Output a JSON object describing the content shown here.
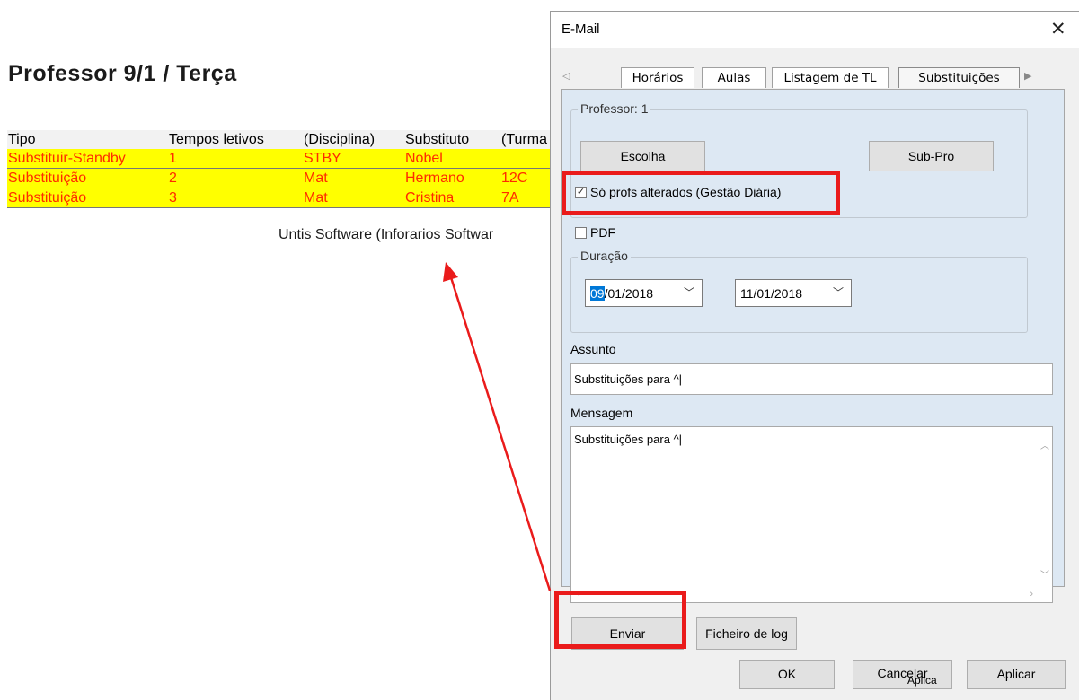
{
  "report": {
    "title": "Professor  9/1 / Terça",
    "headers": [
      "Tipo",
      "Tempos letivos",
      "(Disciplina)",
      "Substituto",
      "(Turma"
    ],
    "rows": [
      [
        "Substituir-Standby",
        "1",
        "STBY",
        "Nobel",
        ""
      ],
      [
        "Substituição",
        "2",
        "Mat",
        "Hermano",
        "12C"
      ],
      [
        "Substituição",
        "3",
        "Mat",
        "Cristina",
        "7A"
      ]
    ],
    "footer": "Untis Software (Inforarios Softwar",
    "row_bg_color": "#ffff00",
    "row_text_color": "#ff2a00"
  },
  "dialog": {
    "title": "E-Mail",
    "close_icon": "close-icon",
    "tabs": [
      "Horários",
      "Aulas",
      "Listagem de TL",
      "Substituições"
    ],
    "active_tab": "Substituições",
    "professor_group": "Professor: 1",
    "escolha_button": "Escolha",
    "subpro_button": "Sub-Pro",
    "checkbox_changed_label": "Só profs alterados (Gestão Diária)",
    "checkbox_changed_checked": true,
    "checkbox_pdf_label": "PDF",
    "checkbox_pdf_checked": false,
    "duracao_group": "Duração",
    "date_from_prefix": "09",
    "date_from_rest": "/01/2018",
    "date_to": "11/01/2018",
    "assunto_label": "Assunto",
    "assunto_value": "Substituições para ^|",
    "mensagem_label": "Mensagem",
    "mensagem_value": "Substituições para ^|",
    "enviar_button": "Enviar",
    "log_button": "Ficheiro de log",
    "ok_button": "OK",
    "cancel_button": "Cancelar",
    "cancel_ghost_text": "Aplica",
    "apply_button": "Aplicar",
    "highlight_color": "#ea1b1b"
  }
}
